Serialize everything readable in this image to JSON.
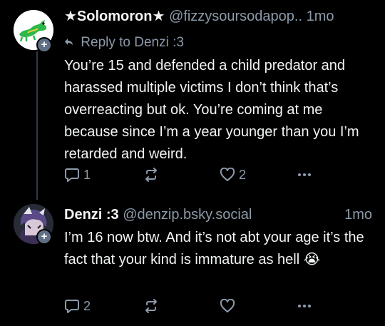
{
  "post1": {
    "display_name": "★Solomoron★",
    "handle": "@fizzysoursodapop..",
    "time": "1mo",
    "reply_label": "Reply to Denzi :3",
    "text": "You’re 15 and defended a child predator and harassed multiple victims I don’t think that’s overreacting but ok. You’re coming at me because since I’m a year younger than you I’m retarded and weird.",
    "reply_count": "1",
    "repost_count": "",
    "like_count": "2"
  },
  "post2": {
    "display_name": "Denzi :3",
    "handle": "@denzip.bsky.social",
    "time": "1mo",
    "text": "I’m 16 now btw. And it’s not abt your age it’s the fact that your kind is immature as hell 😭",
    "reply_count": "2",
    "repost_count": "",
    "like_count": ""
  },
  "colors": {
    "background": "#000000",
    "text": "#f1f3f5",
    "muted": "#8d9aa9",
    "thread_line": "#2e3a48",
    "badge": "#5f7085"
  }
}
